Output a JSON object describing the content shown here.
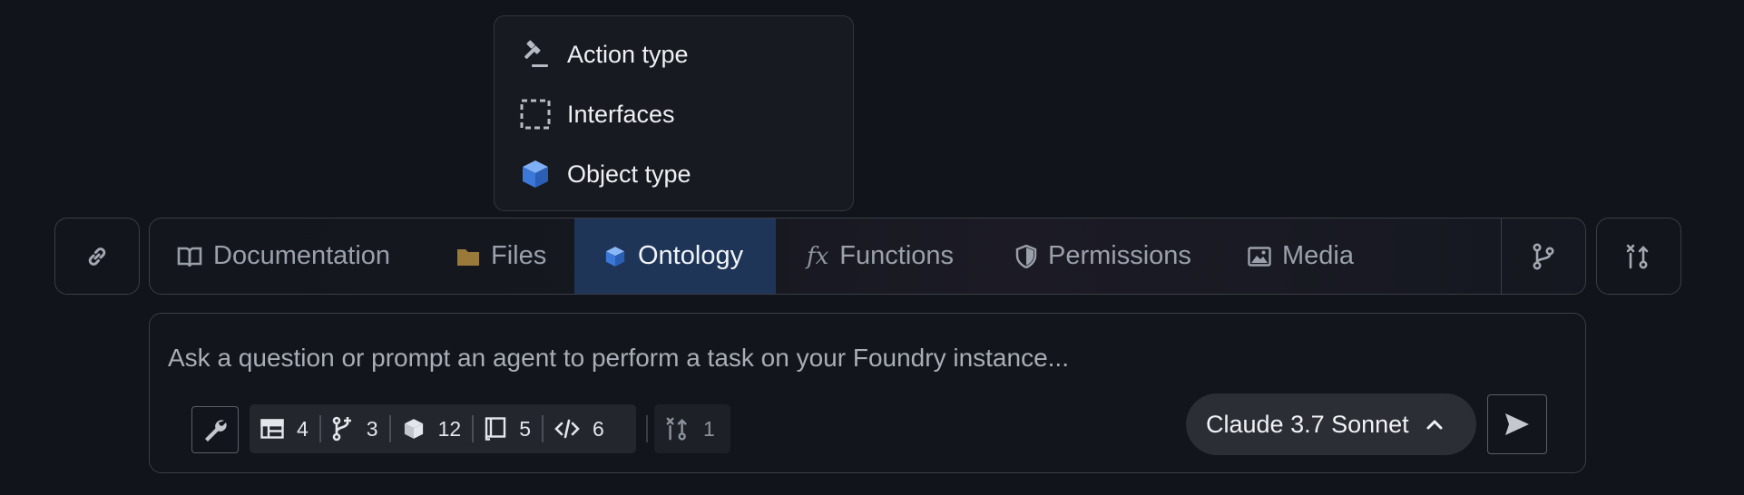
{
  "menu": {
    "items": [
      {
        "label": "Action type",
        "icon": "gavel-icon"
      },
      {
        "label": "Interfaces",
        "icon": "dashed-square-icon"
      },
      {
        "label": "Object type",
        "icon": "cube-icon"
      }
    ]
  },
  "toolbar": {
    "link_icon": "link-icon",
    "tabs": [
      {
        "label": "Documentation",
        "icon": "book-icon"
      },
      {
        "label": "Files",
        "icon": "folder-icon"
      },
      {
        "label": "Ontology",
        "icon": "cube-icon",
        "active": true
      },
      {
        "label": "Functions",
        "icon": "function-icon"
      },
      {
        "label": "Permissions",
        "icon": "shield-icon"
      },
      {
        "label": "Media",
        "icon": "image-icon"
      }
    ],
    "branch_icon": "git-branch-icon",
    "merge_icon": "git-merge-icon"
  },
  "prompt": {
    "placeholder": "Ask a question or prompt an agent to perform a task on your Foundry instance...",
    "context_chips": [
      {
        "icon": "table-icon",
        "count": "4"
      },
      {
        "icon": "git-branch-icon",
        "count": "3"
      },
      {
        "icon": "cube-icon",
        "count": "12"
      },
      {
        "icon": "notebook-icon",
        "count": "5"
      },
      {
        "icon": "code-icon",
        "count": "6"
      }
    ],
    "merge_chip": {
      "icon": "git-merge-icon",
      "count": "1"
    },
    "model": "Claude 3.7 Sonnet"
  },
  "colors": {
    "background": "#11141a",
    "active_tab": "#1f3558",
    "accent_blue": "#3b82f6",
    "folder": "#9a7a3a"
  }
}
